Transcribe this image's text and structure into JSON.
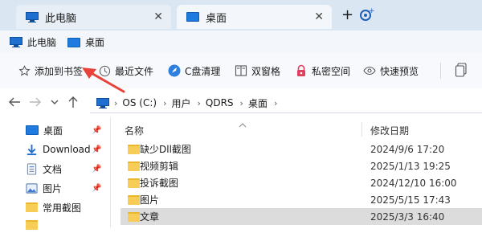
{
  "tabs": [
    {
      "label": "此电脑",
      "icon": "monitor-icon",
      "active": false
    },
    {
      "label": "桌面",
      "icon": "desktop-icon",
      "active": true
    }
  ],
  "favorites": [
    {
      "label": "此电脑",
      "icon": "monitor-icon"
    },
    {
      "label": "桌面",
      "icon": "desktop-icon"
    }
  ],
  "toolbar": {
    "add_bookmark": "添加到书签",
    "recent_files": "最近文件",
    "c_cleanup": "C盘清理",
    "dual_pane": "双窗格",
    "private_space": "私密空间",
    "quick_preview": "快速预览"
  },
  "address": {
    "crumbs": [
      "OS (C:)",
      "用户",
      "QDRS",
      "桌面"
    ]
  },
  "nav": {
    "items": [
      {
        "label": "桌面",
        "pinned": true,
        "icon": "desktop-icon"
      },
      {
        "label": "Download",
        "pinned": true,
        "icon": "download-icon"
      },
      {
        "label": "文档",
        "pinned": true,
        "icon": "document-icon"
      },
      {
        "label": "图片",
        "pinned": true,
        "icon": "picture-icon"
      },
      {
        "label": "常用截图",
        "pinned": false,
        "icon": "folder-icon"
      },
      {
        "label": "",
        "pinned": false,
        "icon": "folder-icon"
      }
    ]
  },
  "files": {
    "columns": {
      "name": "名称",
      "modified": "修改日期"
    },
    "rows": [
      {
        "name": "缺少Dll截图",
        "modified": "2024/9/6 17:20",
        "selected": false
      },
      {
        "name": "视频剪辑",
        "modified": "2025/1/13 19:25",
        "selected": false
      },
      {
        "name": "投诉截图",
        "modified": "2024/12/10 16:00",
        "selected": false
      },
      {
        "name": "图片",
        "modified": "2025/5/15 17:43",
        "selected": false
      },
      {
        "name": "文章",
        "modified": "2025/3/3 16:40",
        "selected": true
      }
    ]
  },
  "colors": {
    "tabbar": "#dbe6f3",
    "accent": "#1f6fd0",
    "folder": "#f7cd57",
    "annotation_arrow": "#e8433a"
  }
}
